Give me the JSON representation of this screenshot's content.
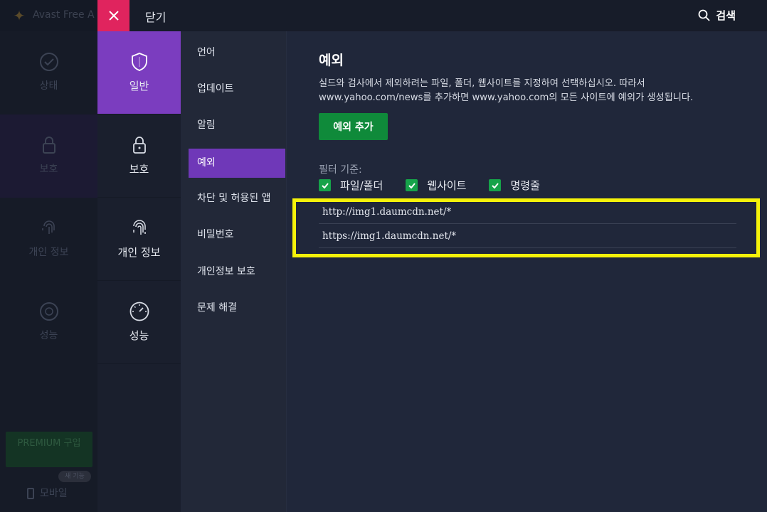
{
  "background_app": {
    "title": "Avast Free A",
    "nav": [
      {
        "label": "상태",
        "icon": "check-circle-icon"
      },
      {
        "label": "보호",
        "icon": "lock-icon"
      },
      {
        "label": "개인 정보",
        "icon": "fingerprint-icon"
      },
      {
        "label": "성능",
        "icon": "gauge-icon"
      }
    ],
    "premium_label": "PREMIUM 구입",
    "new_badge": "새 기능",
    "mobile_label": "모바일"
  },
  "topbar": {
    "close_label": "닫기",
    "search_label": "검색"
  },
  "categories": [
    {
      "label": "일반",
      "icon": "shield-icon",
      "active": true
    },
    {
      "label": "보호",
      "icon": "lock-icon",
      "active": false
    },
    {
      "label": "개인 정보",
      "icon": "fingerprint-icon",
      "active": false
    },
    {
      "label": "성능",
      "icon": "gauge-icon",
      "active": false
    }
  ],
  "subnav": [
    {
      "label": "언어"
    },
    {
      "label": "업데이트"
    },
    {
      "label": "알림"
    },
    {
      "label": "예외"
    },
    {
      "label": "차단 및 허용된 앱"
    },
    {
      "label": "비밀번호"
    },
    {
      "label": "개인정보 보호"
    },
    {
      "label": "문제 해결"
    }
  ],
  "content": {
    "title": "예외",
    "description": "실드와 검사에서 제외하려는 파일, 폴더, 웹사이트를 지정하여 선택하십시오. 따라서 www.yahoo.com/news를 추가하면 www.yahoo.com의 모든 사이트에 예외가 생성됩니다.",
    "add_button": "예외 추가",
    "filter_label": "필터 기준:",
    "filters": [
      {
        "label": "파일/폴더",
        "checked": true
      },
      {
        "label": "웹사이트",
        "checked": true
      },
      {
        "label": "명령줄",
        "checked": true
      }
    ],
    "exceptions": [
      "http://img1.daumcdn.net/*",
      "https://img1.daumcdn.net/*"
    ]
  },
  "colors": {
    "accent_purple": "#7b3dbf",
    "close_red": "#e0245e",
    "button_green": "#0f8a3a",
    "highlight_yellow": "#f5f20a"
  }
}
